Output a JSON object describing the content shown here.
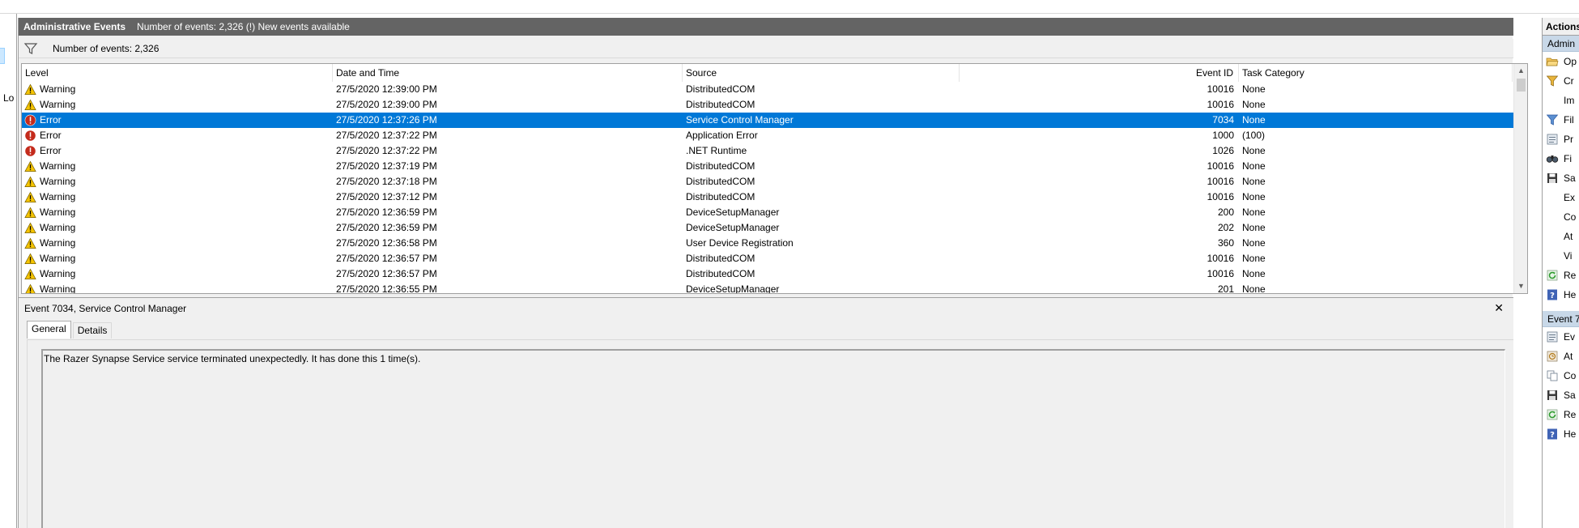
{
  "header": {
    "title": "Administrative Events",
    "status": "Number of events: 2,326 (!) New events available"
  },
  "filter": {
    "text": "Number of events: 2,326"
  },
  "left_tree": {
    "visible_text": "Lo"
  },
  "grid": {
    "columns": {
      "level": "Level",
      "date": "Date and Time",
      "source": "Source",
      "event_id": "Event ID",
      "task_category": "Task Category"
    },
    "rows": [
      {
        "level": "Warning",
        "icon": "warning-icon",
        "date": "27/5/2020 12:39:00 PM",
        "source": "DistributedCOM",
        "event_id": "10016",
        "category": "None",
        "selected": false
      },
      {
        "level": "Warning",
        "icon": "warning-icon",
        "date": "27/5/2020 12:39:00 PM",
        "source": "DistributedCOM",
        "event_id": "10016",
        "category": "None",
        "selected": false
      },
      {
        "level": "Error",
        "icon": "error-icon",
        "date": "27/5/2020 12:37:26 PM",
        "source": "Service Control Manager",
        "event_id": "7034",
        "category": "None",
        "selected": true
      },
      {
        "level": "Error",
        "icon": "error-icon",
        "date": "27/5/2020 12:37:22 PM",
        "source": "Application Error",
        "event_id": "1000",
        "category": "(100)",
        "selected": false
      },
      {
        "level": "Error",
        "icon": "error-icon",
        "date": "27/5/2020 12:37:22 PM",
        "source": ".NET Runtime",
        "event_id": "1026",
        "category": "None",
        "selected": false
      },
      {
        "level": "Warning",
        "icon": "warning-icon",
        "date": "27/5/2020 12:37:19 PM",
        "source": "DistributedCOM",
        "event_id": "10016",
        "category": "None",
        "selected": false
      },
      {
        "level": "Warning",
        "icon": "warning-icon",
        "date": "27/5/2020 12:37:18 PM",
        "source": "DistributedCOM",
        "event_id": "10016",
        "category": "None",
        "selected": false
      },
      {
        "level": "Warning",
        "icon": "warning-icon",
        "date": "27/5/2020 12:37:12 PM",
        "source": "DistributedCOM",
        "event_id": "10016",
        "category": "None",
        "selected": false
      },
      {
        "level": "Warning",
        "icon": "warning-icon",
        "date": "27/5/2020 12:36:59 PM",
        "source": "DeviceSetupManager",
        "event_id": "200",
        "category": "None",
        "selected": false
      },
      {
        "level": "Warning",
        "icon": "warning-icon",
        "date": "27/5/2020 12:36:59 PM",
        "source": "DeviceSetupManager",
        "event_id": "202",
        "category": "None",
        "selected": false
      },
      {
        "level": "Warning",
        "icon": "warning-icon",
        "date": "27/5/2020 12:36:58 PM",
        "source": "User Device Registration",
        "event_id": "360",
        "category": "None",
        "selected": false
      },
      {
        "level": "Warning",
        "icon": "warning-icon",
        "date": "27/5/2020 12:36:57 PM",
        "source": "DistributedCOM",
        "event_id": "10016",
        "category": "None",
        "selected": false
      },
      {
        "level": "Warning",
        "icon": "warning-icon",
        "date": "27/5/2020 12:36:57 PM",
        "source": "DistributedCOM",
        "event_id": "10016",
        "category": "None",
        "selected": false
      },
      {
        "level": "Warning",
        "icon": "warning-icon",
        "date": "27/5/2020 12:36:55 PM",
        "source": "DeviceSetupManager",
        "event_id": "201",
        "category": "None",
        "selected": false
      }
    ]
  },
  "detail": {
    "title": "Event 7034, Service Control Manager",
    "close_glyph": "✕",
    "tabs": [
      {
        "label": "General",
        "active": true
      },
      {
        "label": "Details",
        "active": false
      }
    ],
    "message": "The Razer Synapse Service service terminated unexpectedly.  It has done this 1 time(s)."
  },
  "actions": {
    "title": "Actions",
    "sections": [
      {
        "label": "Admin",
        "items": [
          {
            "label": "Op",
            "icon": "open-folder-icon"
          },
          {
            "label": "Cr",
            "icon": "create-filter-icon"
          },
          {
            "label": "Im",
            "icon": ""
          },
          {
            "label": "Fil",
            "icon": "filter-icon"
          },
          {
            "label": "Pr",
            "icon": "properties-icon"
          },
          {
            "label": "Fi",
            "icon": "find-icon"
          },
          {
            "label": "Sa",
            "icon": "save-icon"
          },
          {
            "label": "Ex",
            "icon": ""
          },
          {
            "label": "Co",
            "icon": ""
          },
          {
            "label": "At",
            "icon": ""
          },
          {
            "label": "Vi",
            "icon": ""
          },
          {
            "label": "Re",
            "icon": "refresh-icon"
          },
          {
            "label": "He",
            "icon": "help-icon"
          }
        ]
      },
      {
        "label": "Event 7",
        "items": [
          {
            "label": "Ev",
            "icon": "event-properties-icon"
          },
          {
            "label": "At",
            "icon": "attach-task-icon"
          },
          {
            "label": "Co",
            "icon": "copy-icon"
          },
          {
            "label": "Sa",
            "icon": "save-icon"
          },
          {
            "label": "Re",
            "icon": "refresh-icon"
          },
          {
            "label": "He",
            "icon": "help-icon"
          }
        ]
      }
    ]
  },
  "colors": {
    "header_bg": "#646464",
    "selection": "#0078d7",
    "warning": "#f5c400",
    "error": "#c42b1c",
    "section_bg": "#c8d8e8"
  }
}
